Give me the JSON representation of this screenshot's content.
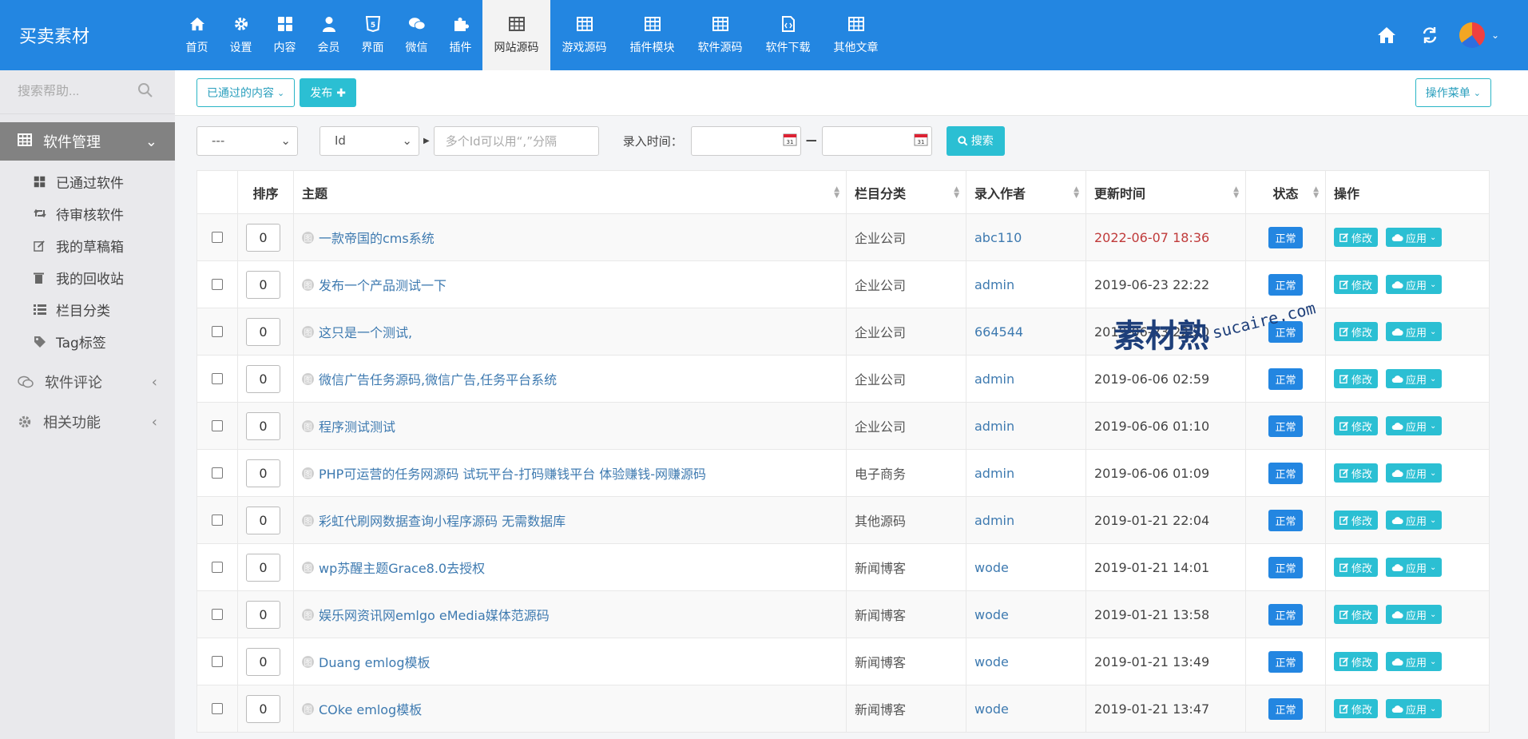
{
  "brand": "买卖素材",
  "topnav": [
    {
      "label": "首页",
      "icon": "home-icon"
    },
    {
      "label": "设置",
      "icon": "gear-icon"
    },
    {
      "label": "内容",
      "icon": "grid-icon"
    },
    {
      "label": "会员",
      "icon": "user-icon"
    },
    {
      "label": "界面",
      "icon": "html5-icon"
    },
    {
      "label": "微信",
      "icon": "wechat-icon"
    },
    {
      "label": "插件",
      "icon": "puzzle-icon"
    },
    {
      "label": "网站源码",
      "icon": "table-icon",
      "active": true
    },
    {
      "label": "游戏源码",
      "icon": "table-icon"
    },
    {
      "label": "插件模块",
      "icon": "table-icon"
    },
    {
      "label": "软件源码",
      "icon": "table-icon"
    },
    {
      "label": "软件下载",
      "icon": "file-code-icon"
    },
    {
      "label": "其他文章",
      "icon": "table-icon"
    }
  ],
  "sidebar": {
    "search_placeholder": "搜索帮助...",
    "active_group": "软件管理",
    "sub_items": [
      {
        "label": "已通过软件",
        "icon": "grid-icon"
      },
      {
        "label": "待审核软件",
        "icon": "retweet-icon"
      },
      {
        "label": "我的草稿箱",
        "icon": "edit-icon"
      },
      {
        "label": "我的回收站",
        "icon": "trash-icon"
      },
      {
        "label": "栏目分类",
        "icon": "list-icon"
      },
      {
        "label": "Tag标签",
        "icon": "tags-icon"
      }
    ],
    "groups": [
      {
        "label": "软件评论",
        "icon": "comments-icon"
      },
      {
        "label": "相关功能",
        "icon": "gear-icon"
      }
    ]
  },
  "toolbar": {
    "filter_label": "已通过的内容",
    "publish_label": "发布",
    "op_menu_label": "操作菜单"
  },
  "filters": {
    "select1_value": "---",
    "select2_value": "Id",
    "ids_placeholder": "多个Id可以用“,”分隔",
    "time_label": "录入时间：",
    "search_label": "搜索"
  },
  "table": {
    "headers": [
      "排序",
      "主题",
      "栏目分类",
      "录入作者",
      "更新时间",
      "状态",
      "操作"
    ],
    "edit_label": "修改",
    "apply_label": "应用",
    "rows": [
      {
        "order": "0",
        "title": "一款帝国的cms系统",
        "category": "企业公司",
        "author": "abc110",
        "time": "2022-06-07 18:36",
        "status": "正常",
        "highlight": true
      },
      {
        "order": "0",
        "title": "发布一个产品测试一下",
        "category": "企业公司",
        "author": "admin",
        "time": "2019-06-23 22:22",
        "status": "正常"
      },
      {
        "order": "0",
        "title": "这只是一个测试,",
        "category": "企业公司",
        "author": "664544",
        "time": "2019-06-23 22:20",
        "status": "正常"
      },
      {
        "order": "0",
        "title": "微信广告任务源码,微信广告,任务平台系统",
        "category": "企业公司",
        "author": "admin",
        "time": "2019-06-06 02:59",
        "status": "正常"
      },
      {
        "order": "0",
        "title": "程序测试测试",
        "category": "企业公司",
        "author": "admin",
        "time": "2019-06-06 01:10",
        "status": "正常"
      },
      {
        "order": "0",
        "title": "PHP可运营的任务网源码 试玩平台-打码赚钱平台 体验赚钱-网赚源码",
        "category": "电子商务",
        "author": "admin",
        "time": "2019-06-06 01:09",
        "status": "正常"
      },
      {
        "order": "0",
        "title": "彩虹代刷网数据查询小程序源码 无需数据库",
        "category": "其他源码",
        "author": "admin",
        "time": "2019-01-21 22:04",
        "status": "正常"
      },
      {
        "order": "0",
        "title": "wp苏醒主题Grace8.0去授权",
        "category": "新闻博客",
        "author": "wode",
        "time": "2019-01-21 14:01",
        "status": "正常"
      },
      {
        "order": "0",
        "title": "娱乐网资讯网emlgo eMedia媒体范源码",
        "category": "新闻博客",
        "author": "wode",
        "time": "2019-01-21 13:58",
        "status": "正常"
      },
      {
        "order": "0",
        "title": "Duang emlog模板",
        "category": "新闻博客",
        "author": "wode",
        "time": "2019-01-21 13:49",
        "status": "正常"
      },
      {
        "order": "0",
        "title": "COke emlog模板",
        "category": "新闻博客",
        "author": "wode",
        "time": "2019-01-21 13:47",
        "status": "正常"
      }
    ]
  },
  "watermark": {
    "main": "素材熟",
    "sub": "sucaire.com"
  },
  "colors": {
    "primary": "#2386e1",
    "teal": "#2bbfd3",
    "sidebar_active": "#828282",
    "date_highlight": "#c03b3b"
  }
}
